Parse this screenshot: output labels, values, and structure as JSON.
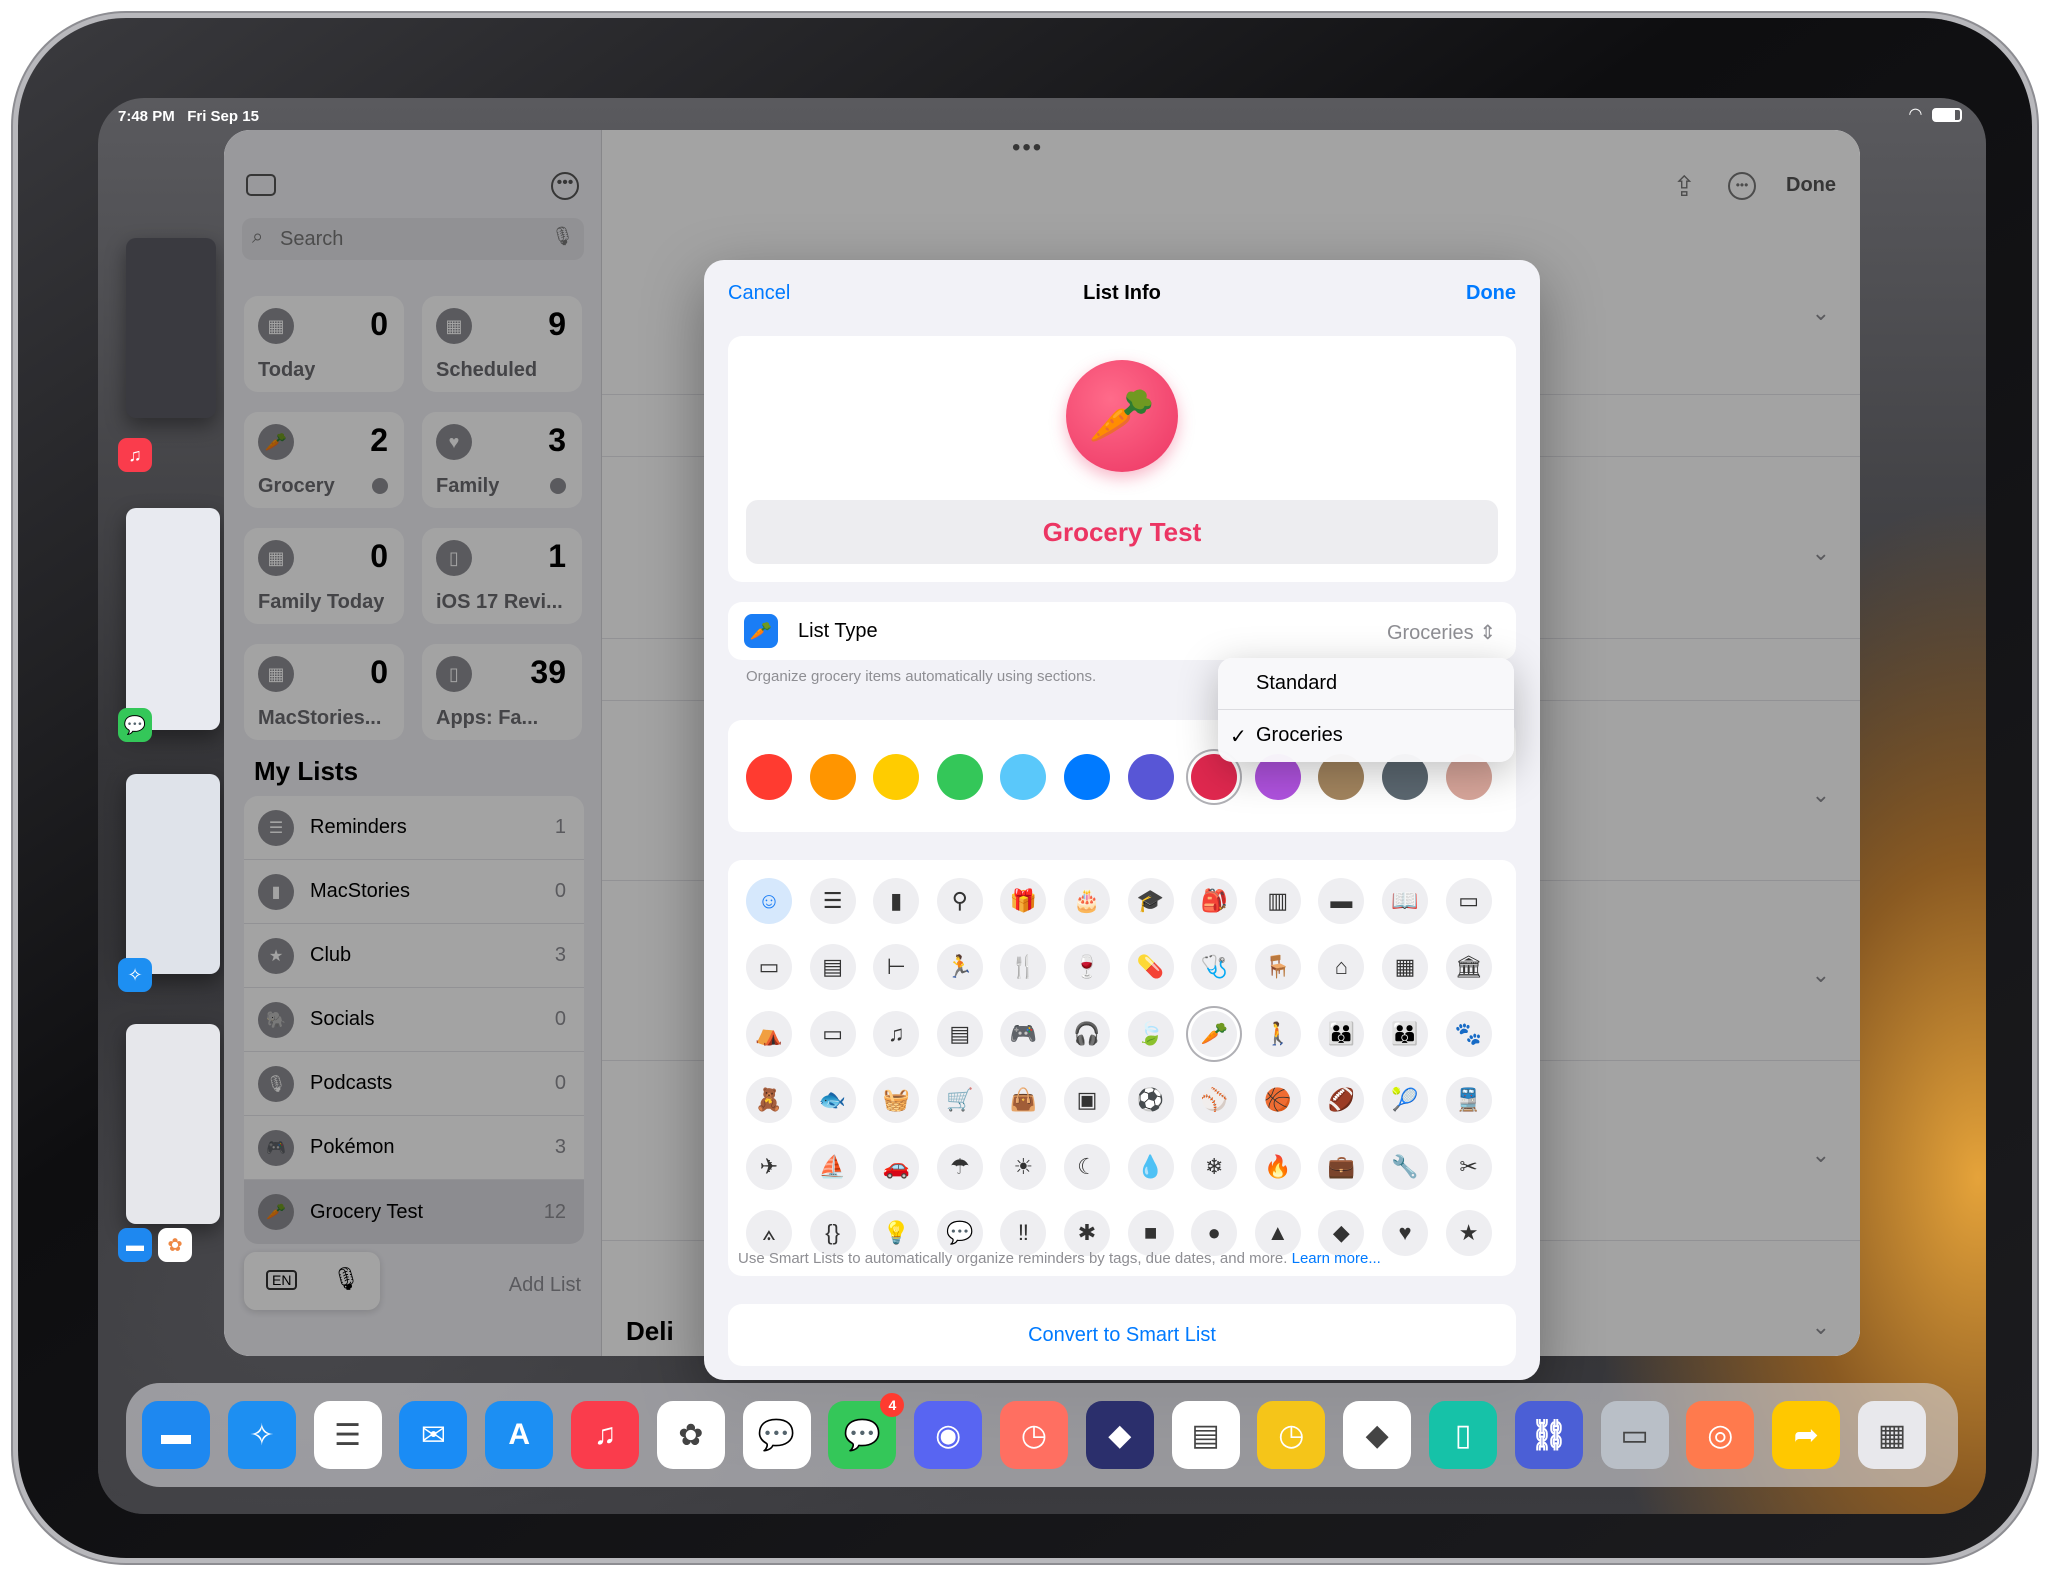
{
  "status_bar": {
    "time": "7:48 PM",
    "date": "Fri Sep 15"
  },
  "sidebar": {
    "search_placeholder": "Search",
    "smart_lists": [
      {
        "label": "Today",
        "count": "0",
        "icon": "calendar-icon"
      },
      {
        "label": "Scheduled",
        "count": "9",
        "icon": "calendar-grid-icon"
      },
      {
        "label": "Grocery",
        "count": "2",
        "icon": "carrot-icon"
      },
      {
        "label": "Family",
        "count": "3",
        "icon": "heart-icon"
      },
      {
        "label": "Family Today",
        "count": "0",
        "icon": "calendar-clock-icon"
      },
      {
        "label": "iOS 17 Revi...",
        "count": "1",
        "icon": "phone-icon"
      },
      {
        "label": "MacStories...",
        "count": "0",
        "icon": "calendar-17-icon"
      },
      {
        "label": "Apps: Fa...",
        "count": "39",
        "icon": "phone-icon"
      }
    ],
    "my_lists_title": "My Lists",
    "lists": [
      {
        "name": "Reminders",
        "count": "1",
        "icon": "list-icon",
        "color": "#8e8e93"
      },
      {
        "name": "MacStories",
        "count": "0",
        "icon": "bookmark-icon",
        "color": "#8e8e93"
      },
      {
        "name": "Club",
        "count": "3",
        "icon": "star-icon",
        "color": "#8e8e93"
      },
      {
        "name": "Socials",
        "count": "0",
        "icon": "elephant-icon",
        "color": "#8e8e93"
      },
      {
        "name": "Podcasts",
        "count": "0",
        "icon": "microphone-icon",
        "color": "#8e8e93"
      },
      {
        "name": "Pokémon",
        "count": "3",
        "icon": "gamecontroller-icon",
        "color": "#8e8e93"
      },
      {
        "name": "Grocery Test",
        "count": "12",
        "icon": "carrot-icon",
        "color": "#8e8e93"
      }
    ],
    "keyboard_lang": "EN",
    "add_list": "Add List"
  },
  "detail": {
    "toolbar_done": "Done",
    "section_deli": "Deli"
  },
  "modal": {
    "cancel": "Cancel",
    "title": "List Info",
    "done": "Done",
    "list_name": "Grocery Test",
    "accent_color": "#ee3b67",
    "list_type_label": "List Type",
    "list_type_value": "Groceries",
    "list_type_hint": "Organize grocery items automatically using sections.",
    "colors": [
      "#ff3b30",
      "#ff9500",
      "#ffcc00",
      "#34c759",
      "#5ac8fa",
      "#007aff",
      "#5856d6",
      "#e0284f",
      "#af52de",
      "#a2845e",
      "#5b6770",
      "#d7a59a"
    ],
    "icons": [
      [
        "☺",
        "☰",
        "▮",
        "⚲",
        "🎁",
        "🎂",
        "🎓",
        "🎒",
        "▥",
        "▬",
        "📖",
        "▭"
      ],
      [
        "▭",
        "▤",
        "⊢",
        "🏃",
        "🍴",
        "🍷",
        "💊",
        "🩺",
        "🪑",
        "⌂",
        "▦",
        "🏛"
      ],
      [
        "⛺",
        "▭",
        "♫",
        "▤",
        "🎮",
        "🎧",
        "🍃",
        "🥕",
        "🚶",
        "👪",
        "👪",
        "🐾"
      ],
      [
        "🧸",
        "🐟",
        "🧺",
        "🛒",
        "👜",
        "▣",
        "⚽",
        "⚾",
        "🏀",
        "🏈",
        "🎾",
        "🚆"
      ],
      [
        "✈",
        "⛵",
        "🚗",
        "☂",
        "☀",
        "☾",
        "💧",
        "❄",
        "🔥",
        "💼",
        "🔧",
        "✂"
      ],
      [
        "⟑",
        "{}",
        "💡",
        "💬",
        "‼",
        "✱",
        "■",
        "●",
        "▲",
        "◆",
        "♥",
        "★"
      ]
    ],
    "convert_button": "Convert to Smart List",
    "footer_text": "Use Smart Lists to automatically organize reminders by tags, due dates, and more.",
    "footer_link": "Learn more..."
  },
  "list_type_menu": {
    "options": [
      "Standard",
      "Groceries"
    ],
    "selected": "Groceries",
    "check": "✓"
  },
  "dock": {
    "apps": [
      {
        "name": "Files",
        "color": "#1e88f0"
      },
      {
        "name": "Safari",
        "color": "#1d8ff2"
      },
      {
        "name": "Reminders",
        "color": "#ffffff"
      },
      {
        "name": "Mail",
        "color": "#1a8cf5"
      },
      {
        "name": "App Store",
        "color": "#1c8ff3"
      },
      {
        "name": "Music",
        "color": "#fa3c4c"
      },
      {
        "name": "Photos",
        "color": "#ffffff"
      },
      {
        "name": "Speeko",
        "color": "#ffffff"
      },
      {
        "name": "Messages",
        "color": "#34c759"
      },
      {
        "name": "Discord",
        "color": "#5865f2"
      },
      {
        "name": "Timery",
        "color": "#ff6f61"
      },
      {
        "name": "Shortcuts",
        "color": "#2b2f6c"
      },
      {
        "name": "Notes",
        "color": "#ffffff"
      },
      {
        "name": "Clock",
        "color": "#f5c519"
      },
      {
        "name": "Obsidian",
        "color": "#ffffff"
      },
      {
        "name": "Sidecar",
        "color": "#16c2a8"
      },
      {
        "name": "Linky",
        "color": "#4b5fd6"
      },
      {
        "name": "Screens",
        "color": "#b9bfc7"
      },
      {
        "name": "Overcast",
        "color": "#ff7a4d"
      },
      {
        "name": "Forward",
        "color": "#ffc800"
      },
      {
        "name": "App Library",
        "color": "#e8e8ec"
      }
    ],
    "messages_badge": "4"
  }
}
